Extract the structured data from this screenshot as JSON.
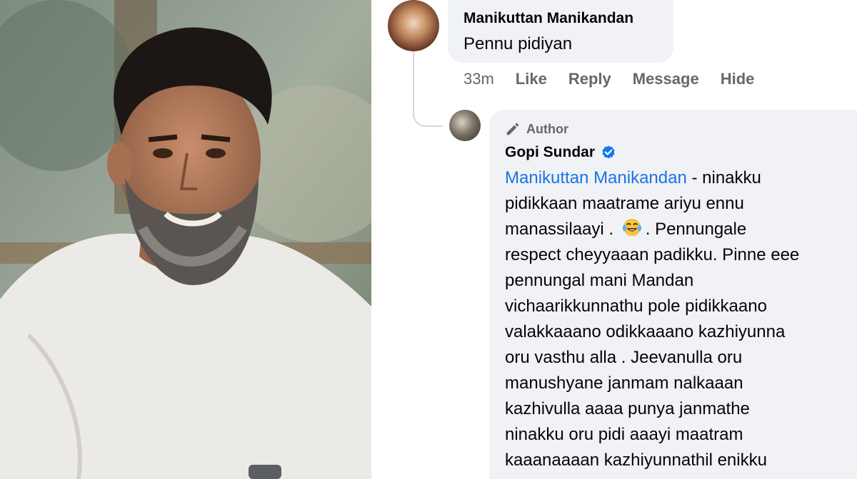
{
  "comment": {
    "author": "Manikuttan Manikandan",
    "text": "Pennu pidiyan",
    "time": "33m",
    "actions": [
      "Like",
      "Reply",
      "Message",
      "Hide"
    ]
  },
  "reply": {
    "badge": "Author",
    "author": "Gopi Sundar",
    "mention": "Manikuttan Manikandan",
    "lines": [
      " - ninakku",
      "pidikkaan maatrame ariyu ennu",
      "manassilaayi .",
      ".  Pennungale",
      "respect cheyyaaan padikku. Pinne eee",
      "pennungal mani Mandan",
      "vichaarikkunnathu pole pidikkaano",
      "valakkaaano odikkaaano kazhiyunna",
      "oru vasthu alla . Jeevanulla oru",
      "manushyane janmam nalkaaan",
      "kazhivulla aaaa punya janmathe",
      "ninakku oru pidi aaayi maatram",
      "kaaanaaaan kazhiyunnathil enikku"
    ]
  },
  "icons": {
    "author_badge": "pencil-icon",
    "verified": "verified-badge-icon",
    "emoji": "laughing-tears-emoji"
  },
  "colors": {
    "bubble": "#f0f2f5",
    "mention": "#1b74e4",
    "meta": "#65676b",
    "verified": "#1877f2"
  }
}
